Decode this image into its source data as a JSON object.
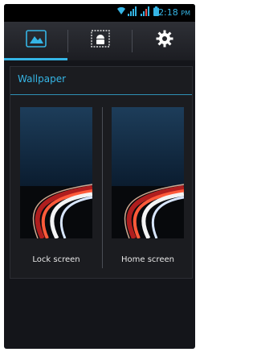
{
  "status_bar": {
    "time": "2:18",
    "ampm": "PM"
  },
  "tabs": [
    {
      "icon": "gallery-icon",
      "active": true
    },
    {
      "icon": "android-icon",
      "active": false
    },
    {
      "icon": "gear-icon",
      "active": false
    }
  ],
  "dialog": {
    "title": "Wallpaper",
    "options": [
      {
        "label": "Lock screen"
      },
      {
        "label": "Home screen"
      }
    ]
  },
  "colors": {
    "accent": "#35b5e5",
    "background": "#14151a"
  }
}
